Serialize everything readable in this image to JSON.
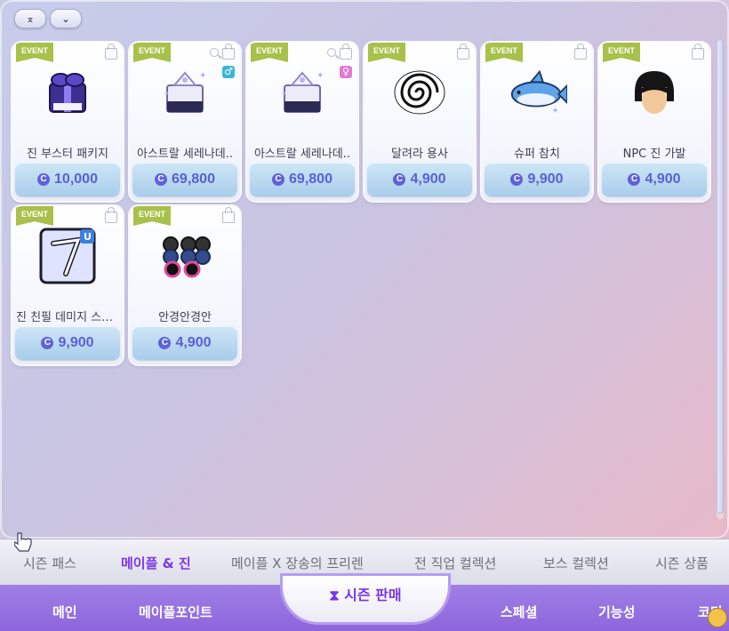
{
  "top_buttons": [
    {
      "icon": "collapse-up-icon",
      "glyph": "⌅"
    },
    {
      "icon": "expand-down-icon",
      "glyph": "⌄"
    }
  ],
  "badge_text": "EVENT",
  "coin_symbol": "C",
  "items": [
    {
      "name": "진 부스터 패키지",
      "price": "10,000",
      "art": "booster-package-icon",
      "search": false,
      "gender": null
    },
    {
      "name": "아스트랄 세레나데..",
      "price": "69,800",
      "art": "astral-box-icon",
      "search": true,
      "gender": "♂"
    },
    {
      "name": "아스트랄 세레나데..",
      "price": "69,800",
      "art": "astral-box-icon",
      "search": true,
      "gender": "♀"
    },
    {
      "name": "달려라 용사",
      "price": "4,900",
      "art": "spiral-icon",
      "search": false,
      "gender": null
    },
    {
      "name": "슈퍼 참치",
      "price": "9,900",
      "art": "tuna-icon",
      "search": false,
      "gender": null
    },
    {
      "name": "NPC 진 가발",
      "price": "4,900",
      "art": "wig-icon",
      "search": false,
      "gender": null
    },
    {
      "name": "진 친필 데미지 스킨..",
      "price": "9,900",
      "art": "damage-skin-icon",
      "search": false,
      "gender": null
    },
    {
      "name": "안경안경안",
      "price": "4,900",
      "art": "glasses-icon",
      "search": false,
      "gender": null
    }
  ],
  "sub_tabs": [
    {
      "label": "시즌 패스",
      "active": false
    },
    {
      "label": "메이플 & 진",
      "active": true
    },
    {
      "label": "메이플 X 장송의 프리렌",
      "active": false
    },
    {
      "label": "전 직업 컬렉션",
      "active": false
    },
    {
      "label": "보스 컬렉션",
      "active": false
    },
    {
      "label": "시즌 상품",
      "active": false
    }
  ],
  "main_tabs": {
    "left": [
      "메인",
      "메이플포인트"
    ],
    "center": "시즌 판매",
    "center_icon": "⧗",
    "right": [
      "스페셜",
      "기능성",
      "코디"
    ]
  },
  "colors": {
    "accent_purple": "#7b35e8",
    "price_blue": "#5a5fd3",
    "event_badge": "#a8c14a",
    "nav_purple": "#9a78e3"
  }
}
